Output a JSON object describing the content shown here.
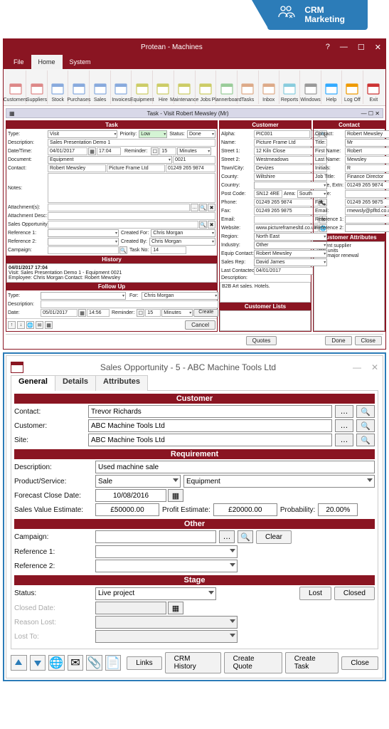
{
  "banner": {
    "l1": "CRM",
    "l2": "Marketing"
  },
  "app1": {
    "title": "Protean - Machines",
    "menus": [
      "File",
      "Home",
      "System"
    ],
    "ribbon": [
      "Customers",
      "Suppliers",
      "Stock",
      "Purchases",
      "Sales",
      "Invoices",
      "Equipment",
      "Hire",
      "Maintenance",
      "Jobs",
      "Plannerboard",
      "Tasks",
      "Inbox",
      "Reports",
      "Windows",
      "Help",
      "Log Off",
      "Exit"
    ],
    "doctitle": "Task - Visit Robert Mewsley (Mr)",
    "task": {
      "type": "Visit",
      "priority": "Low",
      "status": "Done",
      "description": "Sales Presentation Demo 1",
      "date": "04/01/2017",
      "time": "17:04",
      "reminder_on": false,
      "reminder_val": "15",
      "reminder_unit": "Minutes",
      "document": "Equipment",
      "doc_no": "0021",
      "contact": "Robert Mewsley",
      "company": "Picture Frame Ltd",
      "phone": "01249 265 9874",
      "attachment": "",
      "attachment_desc": "",
      "sales_opp": "",
      "ref1": "",
      "created_for": "Chris Morgan",
      "ref2": "",
      "created_by": "Chris Morgan",
      "campaign": "",
      "task_no": "14",
      "labels": {
        "type": "Type:",
        "priority": "Priority:",
        "status": "Status:",
        "desc": "Description:",
        "date": "Date/Time:",
        "reminder": "Reminder:",
        "doc": "Document:",
        "contact": "Contact:",
        "notes": "Notes:",
        "att": "Attachment(s):",
        "attd": "Attachment Desc:",
        "sop": "Sales Opportunity:",
        "r1": "Reference 1:",
        "r2": "Reference 2:",
        "camp": "Campaign:",
        "cfor": "Created For:",
        "cby": "Created By:",
        "tno": "Task No:"
      }
    },
    "history": {
      "title": "History",
      "ts": "04/01/2017 17:04",
      "l1": "Visit: Sales Presentation Demo 1 - Equipment 0021",
      "l2": "Employee: Chris Morgan Contact: Robert Mewsley"
    },
    "followup": {
      "title": "Follow Up",
      "for": "Chris Morgan",
      "type": "",
      "desc": "",
      "date": "05/01/2017",
      "time": "14:56",
      "reminder": "15",
      "unit": "Minutes",
      "create": "Create",
      "labels": {
        "type": "Type:",
        "for": "For:",
        "desc": "Description:",
        "date": "Date:",
        "rem": "Reminder:"
      }
    },
    "customer": {
      "title": "Customer",
      "alpha": "PIC001",
      "name": "Picture Frame Ltd",
      "street1": "12 Kiln Close",
      "street2": "Westmeadows",
      "town": "Devizes",
      "county": "Wiltshire",
      "country": "",
      "postcode": "SN12 4RE",
      "area": "South",
      "phone": "01249 265 9874",
      "fax": "01249 265 9875",
      "email": "",
      "website": "www.pictureframesltd.co.uk",
      "region": "North East",
      "industry": "Other",
      "equip_contact": "Robert Mewsley",
      "sales_rep": "David James",
      "last_contacted": "04/01/2017",
      "desc": "B2B Art sales. Hotels.",
      "labels": {
        "alpha": "Alpha:",
        "name": "Name:",
        "s1": "Street 1:",
        "s2": "Street 2:",
        "town": "Town/City:",
        "county": "County:",
        "country": "Country:",
        "pc": "Post Code:",
        "area": "Area:",
        "phone": "Phone:",
        "fax": "Fax:",
        "email": "Email:",
        "web": "Website:",
        "region": "Region:",
        "ind": "Industry:",
        "ec": "Equip Contact:",
        "sr": "Sales Rep:",
        "lc": "Last Contacted:",
        "desc": "Description:"
      }
    },
    "customer_attrs": {
      "title": "Customer Attributes",
      "r1": "Current supplier",
      "r2": "Total units",
      "r3": "Next major renewal"
    },
    "customer_lists": {
      "title": "Customer Lists"
    },
    "contact": {
      "title": "Contact",
      "contact": "Robert Mewsley",
      "title_v": "Mr",
      "first": "Robert",
      "last": "Mewsley",
      "initials": "R",
      "jobtitle": "Finance Director",
      "ext": "01249 265 9874",
      "mobile": "",
      "fax": "01249 265 9875",
      "email": "rmewsly@pfltd.co.ukq",
      "ref1": "",
      "ref2": "",
      "labels": {
        "contact": "Contact:",
        "title": "Title:",
        "fn": "First Name:",
        "ln": "Last Name:",
        "in": "Initials:",
        "jt": "Job Title:",
        "ext": "Phone, Extn:",
        "mob": "Mobile:",
        "fax": "Fax:",
        "em": "Email:",
        "r1": "Reference 1:",
        "r2": "Reference 2:"
      }
    },
    "buttons": {
      "cancel": "Cancel",
      "quotes": "Quotes",
      "done": "Done",
      "close": "Close"
    }
  },
  "app2": {
    "title": "Sales Opportunity - 5 - ABC Machine Tools Ltd",
    "tabs": [
      "General",
      "Details",
      "Attributes"
    ],
    "customer": {
      "title": "Customer",
      "contact": "Trevor Richards",
      "cust": "ABC Machine Tools Ltd",
      "site": "ABC Machine Tools Ltd",
      "labels": {
        "contact": "Contact:",
        "cust": "Customer:",
        "site": "Site:"
      }
    },
    "req": {
      "title": "Requirement",
      "desc": "Used machine sale",
      "prod": "Sale",
      "prod2": "Equipment",
      "fcd": "10/08/2016",
      "sve": "£50000.00",
      "pe_lbl": "Profit Estimate:",
      "pe": "£20000.00",
      "prob_lbl": "Probability:",
      "prob": "20.00%",
      "labels": {
        "desc": "Description:",
        "prod": "Product/Service:",
        "fcd": "Forecast Close Date:",
        "sve": "Sales Value Estimate:"
      }
    },
    "other": {
      "title": "Other",
      "camp": "",
      "r1": "",
      "r2": "",
      "clear": "Clear",
      "labels": {
        "camp": "Campaign:",
        "r1": "Reference 1:",
        "r2": "Reference 2:"
      }
    },
    "stage": {
      "title": "Stage",
      "status": "Live project",
      "lost": "Lost",
      "closed": "Closed",
      "labels": {
        "status": "Status:",
        "cd": "Closed Date:",
        "rl": "Reason Lost:",
        "lt": "Lost To:"
      }
    },
    "buttons": {
      "links": "Links",
      "crm": "CRM History",
      "cq": "Create Quote",
      "ct": "Create Task",
      "close": "Close"
    }
  }
}
